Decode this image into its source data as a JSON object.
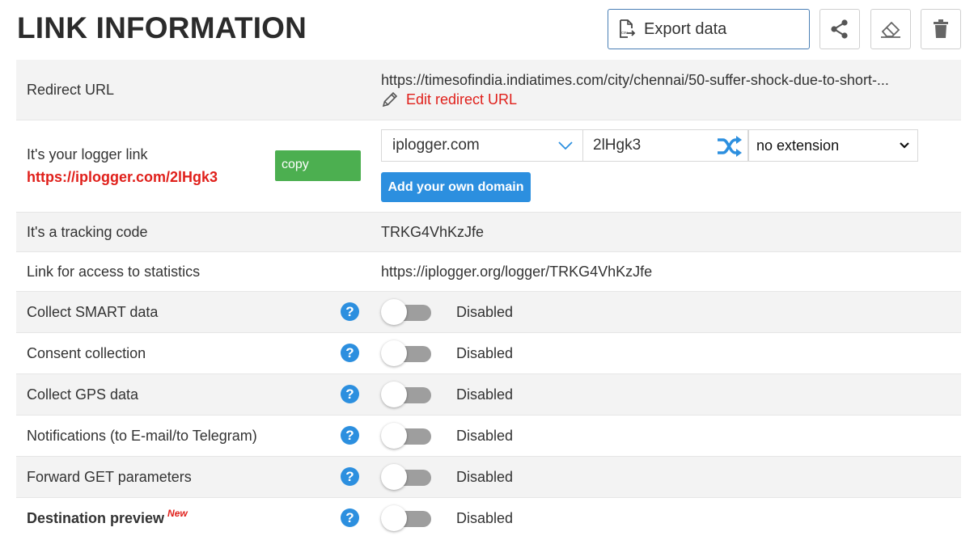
{
  "header": {
    "title": "LINK INFORMATION",
    "export_label": "Export data"
  },
  "rows": {
    "redirect": {
      "label": "Redirect URL",
      "url": "https://timesofindia.indiatimes.com/city/chennai/50-suffer-shock-due-to-short-...",
      "edit_label": "Edit redirect URL"
    },
    "logger": {
      "label": "It's your logger link",
      "url": "https://iplogger.com/2lHgk3",
      "copy_label": "copy",
      "domain_value": "iplogger.com",
      "code_value": "2lHgk3",
      "extension_value": "no extension",
      "add_domain_label": "Add your own domain"
    },
    "tracking": {
      "label": "It's a tracking code",
      "value": "TRKG4VhKzJfe"
    },
    "stats": {
      "label": "Link for access to statistics",
      "value": "https://iplogger.org/logger/TRKG4VhKzJfe"
    }
  },
  "settings": [
    {
      "label": "Collect SMART data",
      "state": "Disabled",
      "enabled": false
    },
    {
      "label": "Consent collection",
      "state": "Disabled",
      "enabled": false
    },
    {
      "label": "Collect GPS data",
      "state": "Disabled",
      "enabled": false
    },
    {
      "label": "Notifications (to E-mail/to Telegram)",
      "state": "Disabled",
      "enabled": false
    },
    {
      "label": "Forward GET parameters",
      "state": "Disabled",
      "enabled": false
    },
    {
      "label": "Destination preview",
      "badge": "New",
      "state": "Disabled",
      "enabled": false
    }
  ],
  "help_glyph": "?",
  "icons": {
    "export": "file-export-icon",
    "share": "share-icon",
    "erase": "eraser-icon",
    "delete": "trash-icon",
    "edit": "pencil-icon",
    "shuffle": "shuffle-icon",
    "help": "question-icon"
  },
  "colors": {
    "accent_blue": "#2c8fdf",
    "red": "#e0201b",
    "green": "#4caf50",
    "toggle_off": "#9e9e9e",
    "row_gray": "#f3f3f3"
  }
}
